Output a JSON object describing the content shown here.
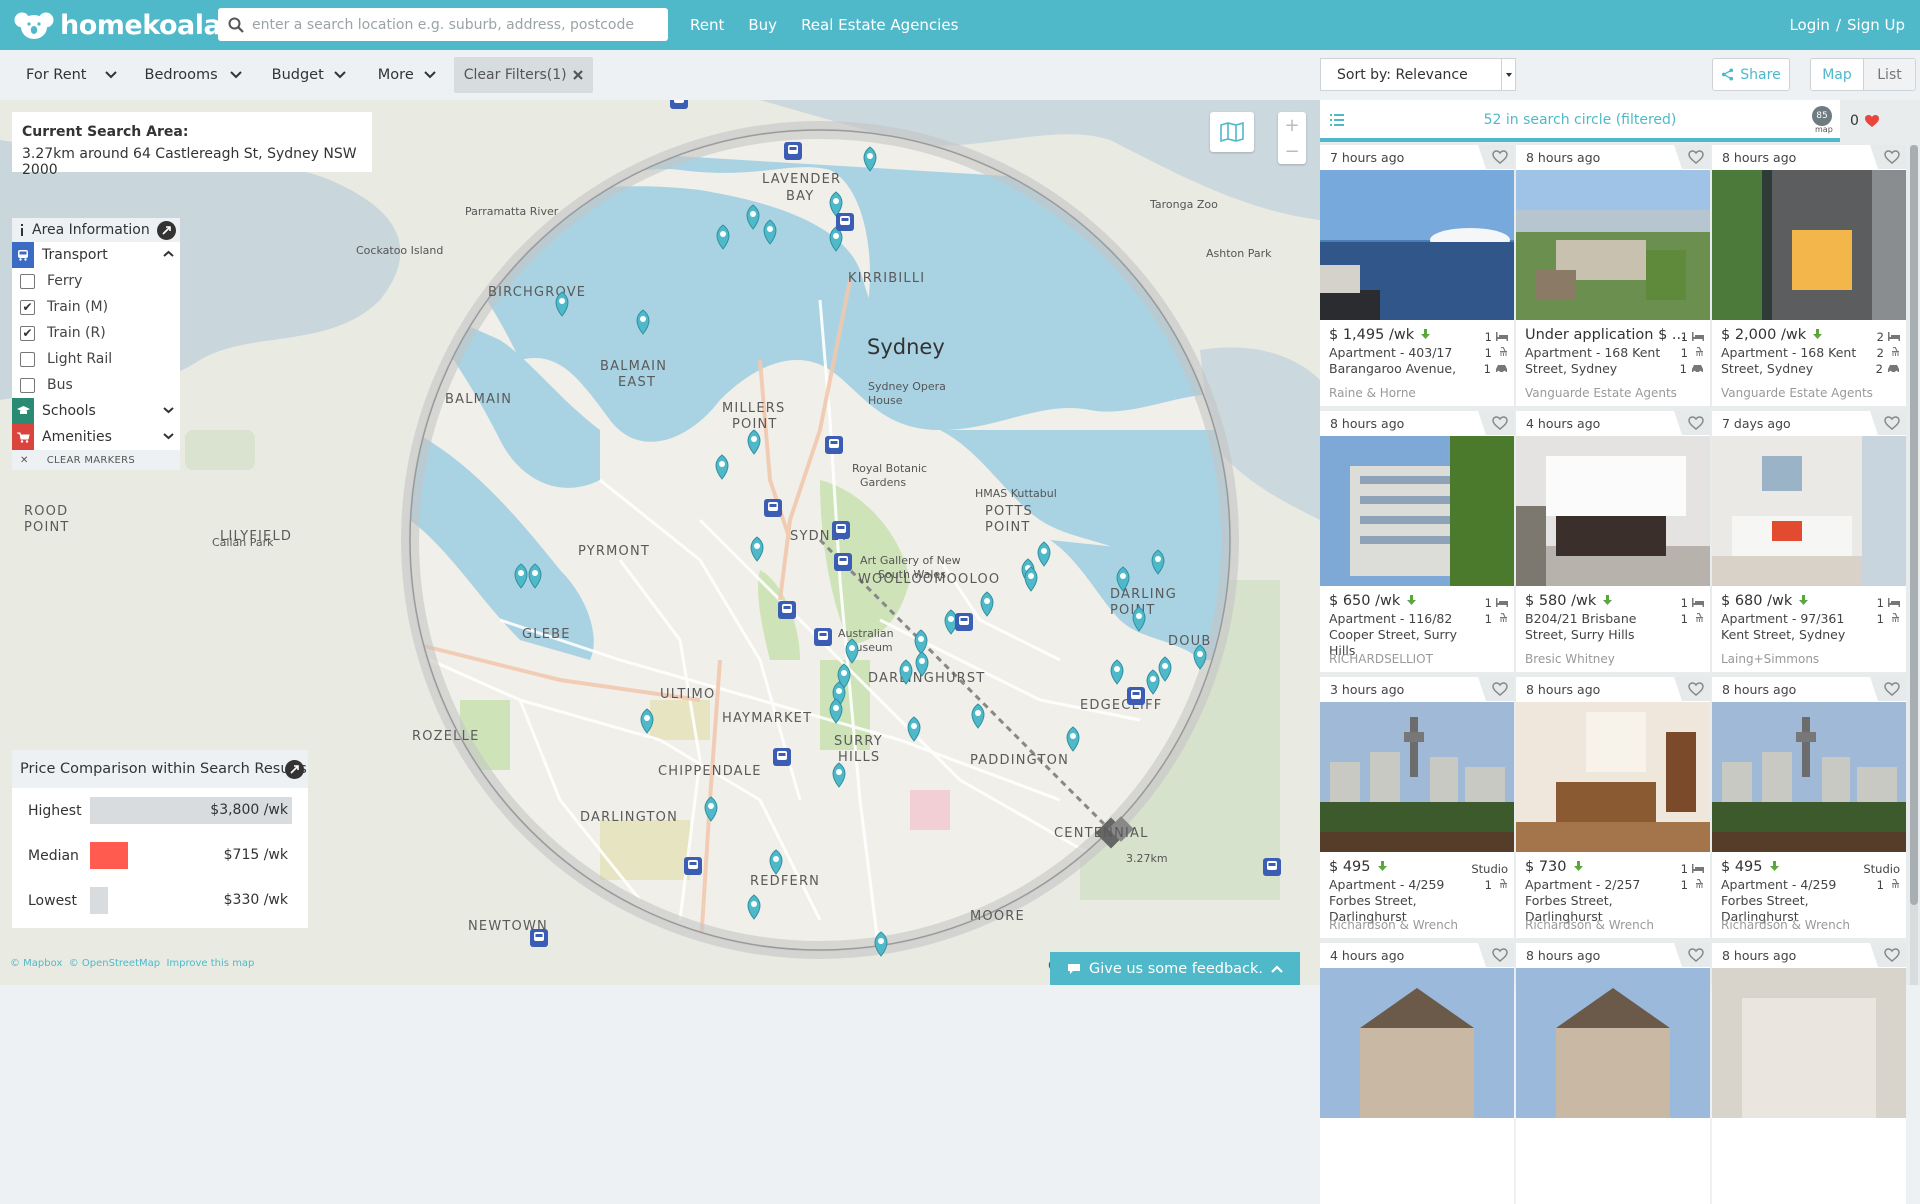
{
  "header": {
    "logo_text": "homekoala",
    "search_placeholder": "enter a search location e.g. suburb, address, postcode",
    "nav": [
      "Rent",
      "Buy",
      "Real Estate Agencies"
    ],
    "login": "Login",
    "separator": "/",
    "signup": "Sign Up",
    "brand_color": "#4fb9c9"
  },
  "filters": {
    "items": [
      "For Rent",
      "Bedrooms",
      "Budget",
      "More"
    ],
    "clear": "Clear Filters(1)"
  },
  "sort": {
    "label": "Sort by: Relevance"
  },
  "share": "Share",
  "view": {
    "map": "Map",
    "list": "List",
    "active": "map"
  },
  "search_area": {
    "title": "Current Search Area:",
    "text": "3.27km around 64 Castlereagh St, Sydney NSW 2000"
  },
  "area_info": {
    "title": "Area Information",
    "transport": {
      "label": "Transport",
      "options": [
        {
          "label": "Ferry",
          "checked": false
        },
        {
          "label": "Train (M)",
          "checked": true
        },
        {
          "label": "Train (R)",
          "checked": true
        },
        {
          "label": "Light Rail",
          "checked": false
        },
        {
          "label": "Bus",
          "checked": false
        }
      ]
    },
    "schools": "Schools",
    "amenities": "Amenities",
    "clear_markers": "CLEAR MARKERS"
  },
  "price_comparison": {
    "title": "Price Comparison within Search Results",
    "rows": [
      {
        "label": "Highest",
        "value": "$3,800 /wk",
        "color": "#d9dcde"
      },
      {
        "label": "Median",
        "value": "$715 /wk",
        "color": "#ff5b4f"
      },
      {
        "label": "Lowest",
        "value": "$330 /wk",
        "color": "#d9dcde"
      }
    ]
  },
  "map": {
    "city_label": "Sydney",
    "radius_label": "3.27km",
    "suburbs": [
      "LAVENDER BAY",
      "KIRRIBILLI",
      "BALMAIN EAST",
      "BALMAIN",
      "MILLERS POINT",
      "SYDNEY",
      "PYRMONT",
      "WOOLLOOMOOLOO",
      "POTTS POINT",
      "DARLING POINT",
      "GLEBE",
      "ULTIMO",
      "HAYMARKET",
      "DARLINGHURST",
      "PADDINGTON",
      "EDGECLIFF",
      "SURRY HILLS",
      "CHIPPENDALE",
      "DARLINGTON",
      "REDFERN",
      "MOORE",
      "CENTENNIAL",
      "NEWTOWN",
      "LILYFIELD",
      "ROZELLE",
      "BIRCHGROVE",
      "DOUBLE"
    ],
    "pois": [
      "Sydney Opera House",
      "Royal Botanic Gardens",
      "Art Gallery of New South Wales",
      "Australian Museum",
      "HMAS Kuttabul",
      "Callan Park",
      "Cockatoo Island",
      "Parramatta River",
      "Taronga Zoo",
      "Ashton Park"
    ],
    "feedback": "Give us some feedback.",
    "attribution": [
      "© Mapbox",
      "© OpenStreetMap",
      "Improve this map"
    ]
  },
  "listings": {
    "count_text": "52 in search circle (filtered)",
    "map_badge": "85",
    "map_badge_sub": "map",
    "favorites": "0",
    "cards": [
      {
        "time": "7 hours ago",
        "price": "$ 1,495 /wk",
        "down": true,
        "addr": "Apartment - 403/17 Barangaroo Avenue,",
        "agency": "Raine & Horne",
        "bed": "1",
        "bath": "1",
        "car": "1",
        "photo": "harbour"
      },
      {
        "time": "8 hours ago",
        "price": "Under application $ ...",
        "down": false,
        "addr": "Apartment - 168 Kent Street, Sydney",
        "agency": "Vanguarde Estate Agents",
        "bed": "1",
        "bath": "1",
        "car": "1",
        "photo": "city-park"
      },
      {
        "time": "8 hours ago",
        "price": "$ 2,000 /wk",
        "down": true,
        "addr": "Apartment - 168 Kent Street, Sydney",
        "agency": "Vanguarde Estate Agents",
        "bed": "2",
        "bath": "2",
        "car": "2",
        "photo": "tower-night"
      },
      {
        "time": "8 hours ago",
        "price": "$ 650 /wk",
        "down": true,
        "addr": "Apartment - 116/82 Cooper Street, Surry Hills",
        "agency": "RICHARDSELLIOT",
        "bed": "1",
        "bath": "1",
        "car": "",
        "photo": "building"
      },
      {
        "time": "4 hours ago",
        "price": "$ 580 /wk",
        "down": true,
        "addr": "B204/21 Brisbane Street, Surry Hills",
        "agency": "Bresic Whitney",
        "bed": "1",
        "bath": "1",
        "car": "",
        "photo": "room"
      },
      {
        "time": "7 days ago",
        "price": "$ 680 /wk",
        "down": true,
        "addr": "Apartment - 97/361 Kent Street, Sydney",
        "agency": "Laing+Simmons",
        "bed": "1",
        "bath": "1",
        "car": "",
        "photo": "lounge"
      },
      {
        "time": "3 hours ago",
        "price": "$ 495",
        "down": true,
        "addr": "Apartment - 4/259 Forbes Street, Darlinghurst",
        "agency": "Richardson & Wrench",
        "bed": "Studio",
        "bath": "1",
        "car": "",
        "photo": "skyline"
      },
      {
        "time": "8 hours ago",
        "price": "$ 730",
        "down": true,
        "addr": "Apartment - 2/257 Forbes Street, Darlinghurst",
        "agency": "Richardson & Wrench",
        "bed": "1",
        "bath": "1",
        "car": "",
        "photo": "dining"
      },
      {
        "time": "8 hours ago",
        "price": "$ 495",
        "down": true,
        "addr": "Apartment - 4/259 Forbes Street, Darlinghurst",
        "agency": "Richardson & Wrench",
        "bed": "Studio",
        "bath": "1",
        "car": "",
        "photo": "skyline"
      },
      {
        "time": "4 hours ago",
        "price": "",
        "down": false,
        "addr": "",
        "agency": "",
        "bed": "",
        "bath": "",
        "car": "",
        "photo": "house"
      },
      {
        "time": "8 hours ago",
        "price": "",
        "down": false,
        "addr": "",
        "agency": "",
        "bed": "",
        "bath": "",
        "car": "",
        "photo": "house"
      },
      {
        "time": "8 hours ago",
        "price": "",
        "down": false,
        "addr": "",
        "agency": "",
        "bed": "",
        "bath": "",
        "car": "",
        "photo": "house2"
      }
    ]
  }
}
